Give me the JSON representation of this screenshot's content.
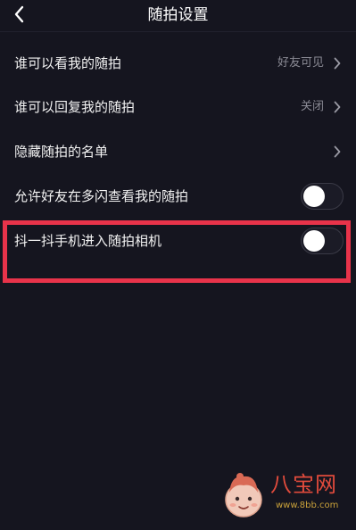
{
  "header": {
    "title": "随拍设置",
    "back_icon": "chevron-left-icon"
  },
  "settings": [
    {
      "label": "谁可以看我的随拍",
      "value": "好友可见",
      "control": "chevron"
    },
    {
      "label": "谁可以回复我的随拍",
      "value": "关闭",
      "control": "chevron"
    },
    {
      "label": "隐藏随拍的名单",
      "value": "",
      "control": "chevron"
    },
    {
      "label": "允许好友在多闪查看我的随拍",
      "control": "toggle",
      "on": false
    },
    {
      "label": "抖一抖手机进入随拍相机",
      "control": "toggle",
      "on": false
    }
  ],
  "highlight": {
    "color": "#e8334a",
    "target": "抖一抖手机进入随拍相机"
  },
  "watermark": {
    "brand": "八宝网",
    "url": "www.8bb.com"
  },
  "colors": {
    "background": "#15151f",
    "text_primary": "#f2f2f2",
    "text_secondary": "#8a8a94",
    "toggle_off_track": "#1b1b26",
    "toggle_knob": "#ffffff"
  }
}
